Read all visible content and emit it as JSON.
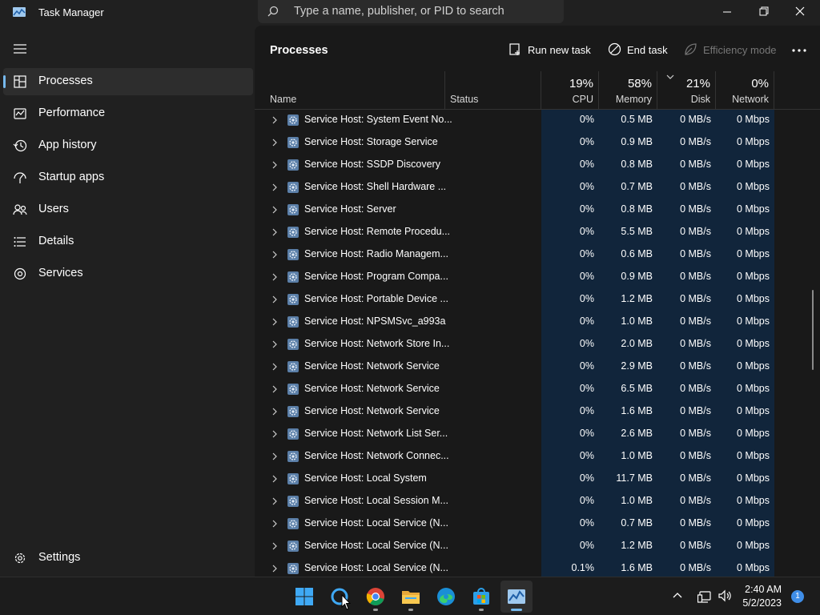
{
  "window": {
    "title": "Task Manager",
    "search_placeholder": "Type a name, publisher, or PID to search"
  },
  "sidebar": {
    "items": [
      {
        "label": "Processes",
        "icon": "processes-icon",
        "active": true
      },
      {
        "label": "Performance",
        "icon": "performance-icon"
      },
      {
        "label": "App history",
        "icon": "app-history-icon"
      },
      {
        "label": "Startup apps",
        "icon": "startup-apps-icon"
      },
      {
        "label": "Users",
        "icon": "users-icon"
      },
      {
        "label": "Details",
        "icon": "details-icon"
      },
      {
        "label": "Services",
        "icon": "services-icon"
      }
    ],
    "settings_label": "Settings"
  },
  "toolbar": {
    "page_title": "Processes",
    "run_new_task": "Run new task",
    "end_task": "End task",
    "efficiency_mode": "Efficiency mode"
  },
  "columns": {
    "name": "Name",
    "status": "Status",
    "cpu": {
      "label": "CPU",
      "percent": "19%"
    },
    "memory": {
      "label": "Memory",
      "percent": "58%"
    },
    "disk": {
      "label": "Disk",
      "percent": "21%"
    },
    "network": {
      "label": "Network",
      "percent": "0%"
    }
  },
  "processes": [
    {
      "name": "Service Host: System Event No...",
      "cpu": "0%",
      "memory": "0.5 MB",
      "disk": "0 MB/s",
      "network": "0 Mbps"
    },
    {
      "name": "Service Host: Storage Service",
      "cpu": "0%",
      "memory": "0.9 MB",
      "disk": "0 MB/s",
      "network": "0 Mbps"
    },
    {
      "name": "Service Host: SSDP Discovery",
      "cpu": "0%",
      "memory": "0.8 MB",
      "disk": "0 MB/s",
      "network": "0 Mbps"
    },
    {
      "name": "Service Host: Shell Hardware ...",
      "cpu": "0%",
      "memory": "0.7 MB",
      "disk": "0 MB/s",
      "network": "0 Mbps"
    },
    {
      "name": "Service Host: Server",
      "cpu": "0%",
      "memory": "0.8 MB",
      "disk": "0 MB/s",
      "network": "0 Mbps"
    },
    {
      "name": "Service Host: Remote Procedu...",
      "cpu": "0%",
      "memory": "5.5 MB",
      "disk": "0 MB/s",
      "network": "0 Mbps"
    },
    {
      "name": "Service Host: Radio Managem...",
      "cpu": "0%",
      "memory": "0.6 MB",
      "disk": "0 MB/s",
      "network": "0 Mbps"
    },
    {
      "name": "Service Host: Program Compa...",
      "cpu": "0%",
      "memory": "0.9 MB",
      "disk": "0 MB/s",
      "network": "0 Mbps"
    },
    {
      "name": "Service Host: Portable Device ...",
      "cpu": "0%",
      "memory": "1.2 MB",
      "disk": "0 MB/s",
      "network": "0 Mbps"
    },
    {
      "name": "Service Host: NPSMSvc_a993a",
      "cpu": "0%",
      "memory": "1.0 MB",
      "disk": "0 MB/s",
      "network": "0 Mbps"
    },
    {
      "name": "Service Host: Network Store In...",
      "cpu": "0%",
      "memory": "2.0 MB",
      "disk": "0 MB/s",
      "network": "0 Mbps"
    },
    {
      "name": "Service Host: Network Service",
      "cpu": "0%",
      "memory": "2.9 MB",
      "disk": "0 MB/s",
      "network": "0 Mbps"
    },
    {
      "name": "Service Host: Network Service",
      "cpu": "0%",
      "memory": "6.5 MB",
      "disk": "0 MB/s",
      "network": "0 Mbps"
    },
    {
      "name": "Service Host: Network Service",
      "cpu": "0%",
      "memory": "1.6 MB",
      "disk": "0 MB/s",
      "network": "0 Mbps"
    },
    {
      "name": "Service Host: Network List Ser...",
      "cpu": "0%",
      "memory": "2.6 MB",
      "disk": "0 MB/s",
      "network": "0 Mbps"
    },
    {
      "name": "Service Host: Network Connec...",
      "cpu": "0%",
      "memory": "1.0 MB",
      "disk": "0 MB/s",
      "network": "0 Mbps"
    },
    {
      "name": "Service Host: Local System",
      "cpu": "0%",
      "memory": "11.7 MB",
      "disk": "0 MB/s",
      "network": "0 Mbps"
    },
    {
      "name": "Service Host: Local Session M...",
      "cpu": "0%",
      "memory": "1.0 MB",
      "disk": "0 MB/s",
      "network": "0 Mbps"
    },
    {
      "name": "Service Host: Local Service (N...",
      "cpu": "0%",
      "memory": "0.7 MB",
      "disk": "0 MB/s",
      "network": "0 Mbps"
    },
    {
      "name": "Service Host: Local Service (N...",
      "cpu": "0%",
      "memory": "1.2 MB",
      "disk": "0 MB/s",
      "network": "0 Mbps"
    },
    {
      "name": "Service Host: Local Service (N...",
      "cpu": "0.1%",
      "memory": "1.6 MB",
      "disk": "0 MB/s",
      "network": "0 Mbps"
    }
  ],
  "taskbar": {
    "apps": [
      "start-icon",
      "cortana-icon",
      "chrome-icon",
      "file-explorer-icon",
      "edge-icon",
      "microsoft-store-icon",
      "task-manager-icon"
    ],
    "time": "2:40 AM",
    "date": "5/2/2023",
    "notification_count": "1"
  },
  "colors": {
    "accent": "#76b9ed",
    "highlight_column": "#11253b",
    "background": "#202020"
  }
}
